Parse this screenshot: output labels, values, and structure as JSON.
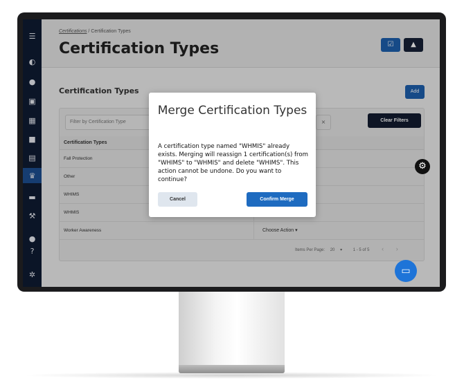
{
  "breadcrumb": {
    "link": "Certifications",
    "separator": "/",
    "current": "Certification Types"
  },
  "header": {
    "title": "Certification Types",
    "task_icon": "clipboard-check-icon",
    "bell_icon": "bell-icon"
  },
  "section": {
    "title": "Certification Types",
    "add_label": "Add"
  },
  "filters": {
    "placeholder": "Filter by Certification Type",
    "chip_close": "×",
    "clear_label": "Clear Filters"
  },
  "table": {
    "header": "Certification Types",
    "rows": [
      {
        "name": "Fall Protection",
        "action": ""
      },
      {
        "name": "Other",
        "action": ""
      },
      {
        "name": "WHIMS",
        "action": ""
      },
      {
        "name": "WHMIS",
        "action": ""
      },
      {
        "name": "Worker Awareness",
        "action": "Choose Action ▾"
      }
    ]
  },
  "pager": {
    "items_label": "Items Per Page:",
    "per_page": "20",
    "dropdown": "▾",
    "range": "1 - 5 of 5",
    "prev": "‹",
    "next": "›"
  },
  "modal": {
    "title": "Merge Certification Types",
    "body": "A certification type named \"WHMIS\" already exists. Merging will reassign 1 certification(s) from \"WHIMS\" to \"WHMIS\" and delete \"WHIMS\". This action cannot be undone. Do you want to continue?",
    "cancel_label": "Cancel",
    "confirm_label": "Confirm Merge"
  },
  "icons": {
    "menu": "☰",
    "dashboard": "◐",
    "chat": "●",
    "report": "▣",
    "grid": "▦",
    "folder": "■",
    "badge": "▤",
    "trophy": "♛",
    "book": "▬",
    "tools": "⚒",
    "check": "●",
    "help": "?",
    "settings": "✲",
    "task": "☑",
    "bell": "🔔",
    "gear": "⚙",
    "chat_fab": "▭"
  },
  "colors": {
    "sidebar": "#0f1b33",
    "primary": "#1d5fae",
    "confirm": "#1e6bc0",
    "dark_button": "#121c30"
  }
}
